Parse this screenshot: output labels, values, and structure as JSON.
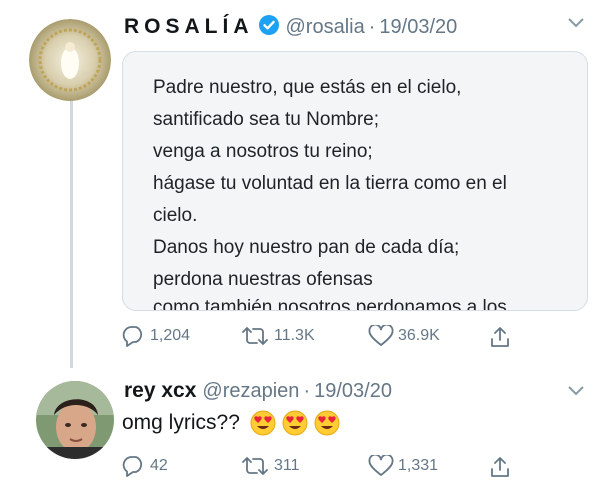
{
  "tweet": {
    "display_name": "ROSALÍA",
    "handle": "@rosalia",
    "separator": "·",
    "date": "19/03/20",
    "quote_lines": [
      "Padre nuestro, que estás en el cielo,",
      "santificado sea tu Nombre;",
      "venga a nosotros tu reino;",
      "hágase tu voluntad en la tierra como en el",
      "cielo.",
      "Danos hoy nuestro pan de cada día;",
      "perdona nuestras ofensas",
      "como también nosotros perdonamos a los"
    ],
    "stats": {
      "replies": "1,204",
      "retweets": "11.3K",
      "likes": "36.9K"
    }
  },
  "reply": {
    "display_name": "rey xcx",
    "handle": "@rezapien",
    "separator": "·",
    "date": "19/03/20",
    "text": "omg lyrics??",
    "emojis": [
      "heart-eyes",
      "heart-eyes",
      "heart-eyes"
    ],
    "stats": {
      "replies": "42",
      "retweets": "311",
      "likes": "1,331"
    }
  },
  "icons": {
    "verified": "verified-badge-icon",
    "caret": "chevron-down-icon",
    "reply": "reply-icon",
    "retweet": "retweet-icon",
    "like": "heart-icon",
    "share": "share-icon"
  },
  "colors": {
    "verified_blue": "#1da1f2",
    "meta_gray": "#657786",
    "quote_bg": "#f3f5f7"
  }
}
